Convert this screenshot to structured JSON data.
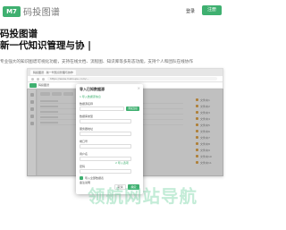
{
  "header": {
    "logo_badge": "M7",
    "logo_text": "码投图谱",
    "login_label": "登录",
    "register_label": "注册"
  },
  "hero": {
    "title_line1": "码投图谱",
    "title_line2": "新一代知识管理与协 |",
    "subtitle": "专业强大的知识图谱可视化功能，支持在线文档、流程图、知识库等多形态功能，支持个人和团队在线协作"
  },
  "browser": {
    "tab_label": "码投图谱 · 新一代知识管理与协作",
    "address": "https://www.matoupu.com/...",
    "app_name": "码投图谱"
  },
  "dialog": {
    "title": "导入已知数据源",
    "close": "×",
    "section1": "1 导入数据源信息",
    "source_label": "数据源名称",
    "source_value": "",
    "source_button": "测试连接",
    "type_label": "数据库类型",
    "host_label": "服务器地址",
    "port_label": "端口号",
    "user_label": "用户名",
    "password_label": "密码",
    "section2": "2 导入选项",
    "checkbox_label": "导入全部数据表",
    "notes_label": "备注说明",
    "cancel": "取消",
    "confirm": "确定"
  },
  "right_panel": {
    "items": [
      "文件夹1",
      "文件夹2",
      "文件夹3",
      "文件夹4",
      "文件夹5",
      "文件夹6",
      "文件夹7",
      "文件夹8",
      "文件夹9",
      "文件夹10",
      "文件夹11"
    ]
  },
  "watermark": "领航网站导航",
  "colors": {
    "brand_green": "#3fb070",
    "watermark_green": "#54c88c"
  }
}
